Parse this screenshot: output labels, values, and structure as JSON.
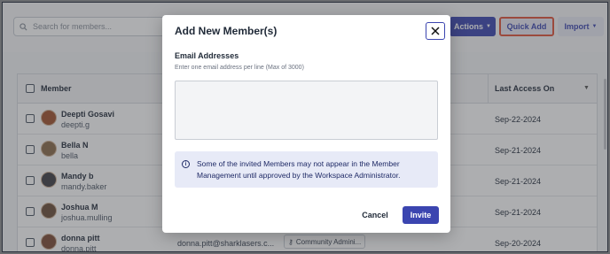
{
  "toolbar": {
    "search_placeholder": "Search for members...",
    "actions_label": "Actions",
    "quick_add_label": "Quick Add",
    "import_label": "Import"
  },
  "table": {
    "columns": {
      "member": "Member",
      "last_access": "Last Access On"
    },
    "rows": [
      {
        "name": "Deepti Gosavi",
        "username": "deepti.g",
        "date": "Sep-22-2024",
        "email": "",
        "role": ""
      },
      {
        "name": "Bella N",
        "username": "bella",
        "date": "Sep-21-2024",
        "email": "",
        "role": ""
      },
      {
        "name": "Mandy b",
        "username": "mandy.baker",
        "date": "Sep-21-2024",
        "email": "",
        "role": ""
      },
      {
        "name": "Joshua M",
        "username": "joshua.mulling",
        "date": "Sep-21-2024",
        "email": "",
        "role": ""
      },
      {
        "name": "donna pitt",
        "username": "donna.pitt",
        "date": "Sep-20-2024",
        "email": "donna.pitt@sharklasers.c...",
        "role": "Community Admini..."
      }
    ]
  },
  "modal": {
    "title": "Add New Member(s)",
    "field_label": "Email Addresses",
    "field_hint": "Enter one email address per line (Max of 3000)",
    "textarea_value": "",
    "info_text": "Some of the invited Members may not appear in the Member Management until approved by the Workspace Administrator.",
    "cancel_label": "Cancel",
    "invite_label": "Invite"
  },
  "colors": {
    "primary": "#3b45b0",
    "highlight": "#e0533a",
    "info_bg": "#e7eaf7"
  }
}
